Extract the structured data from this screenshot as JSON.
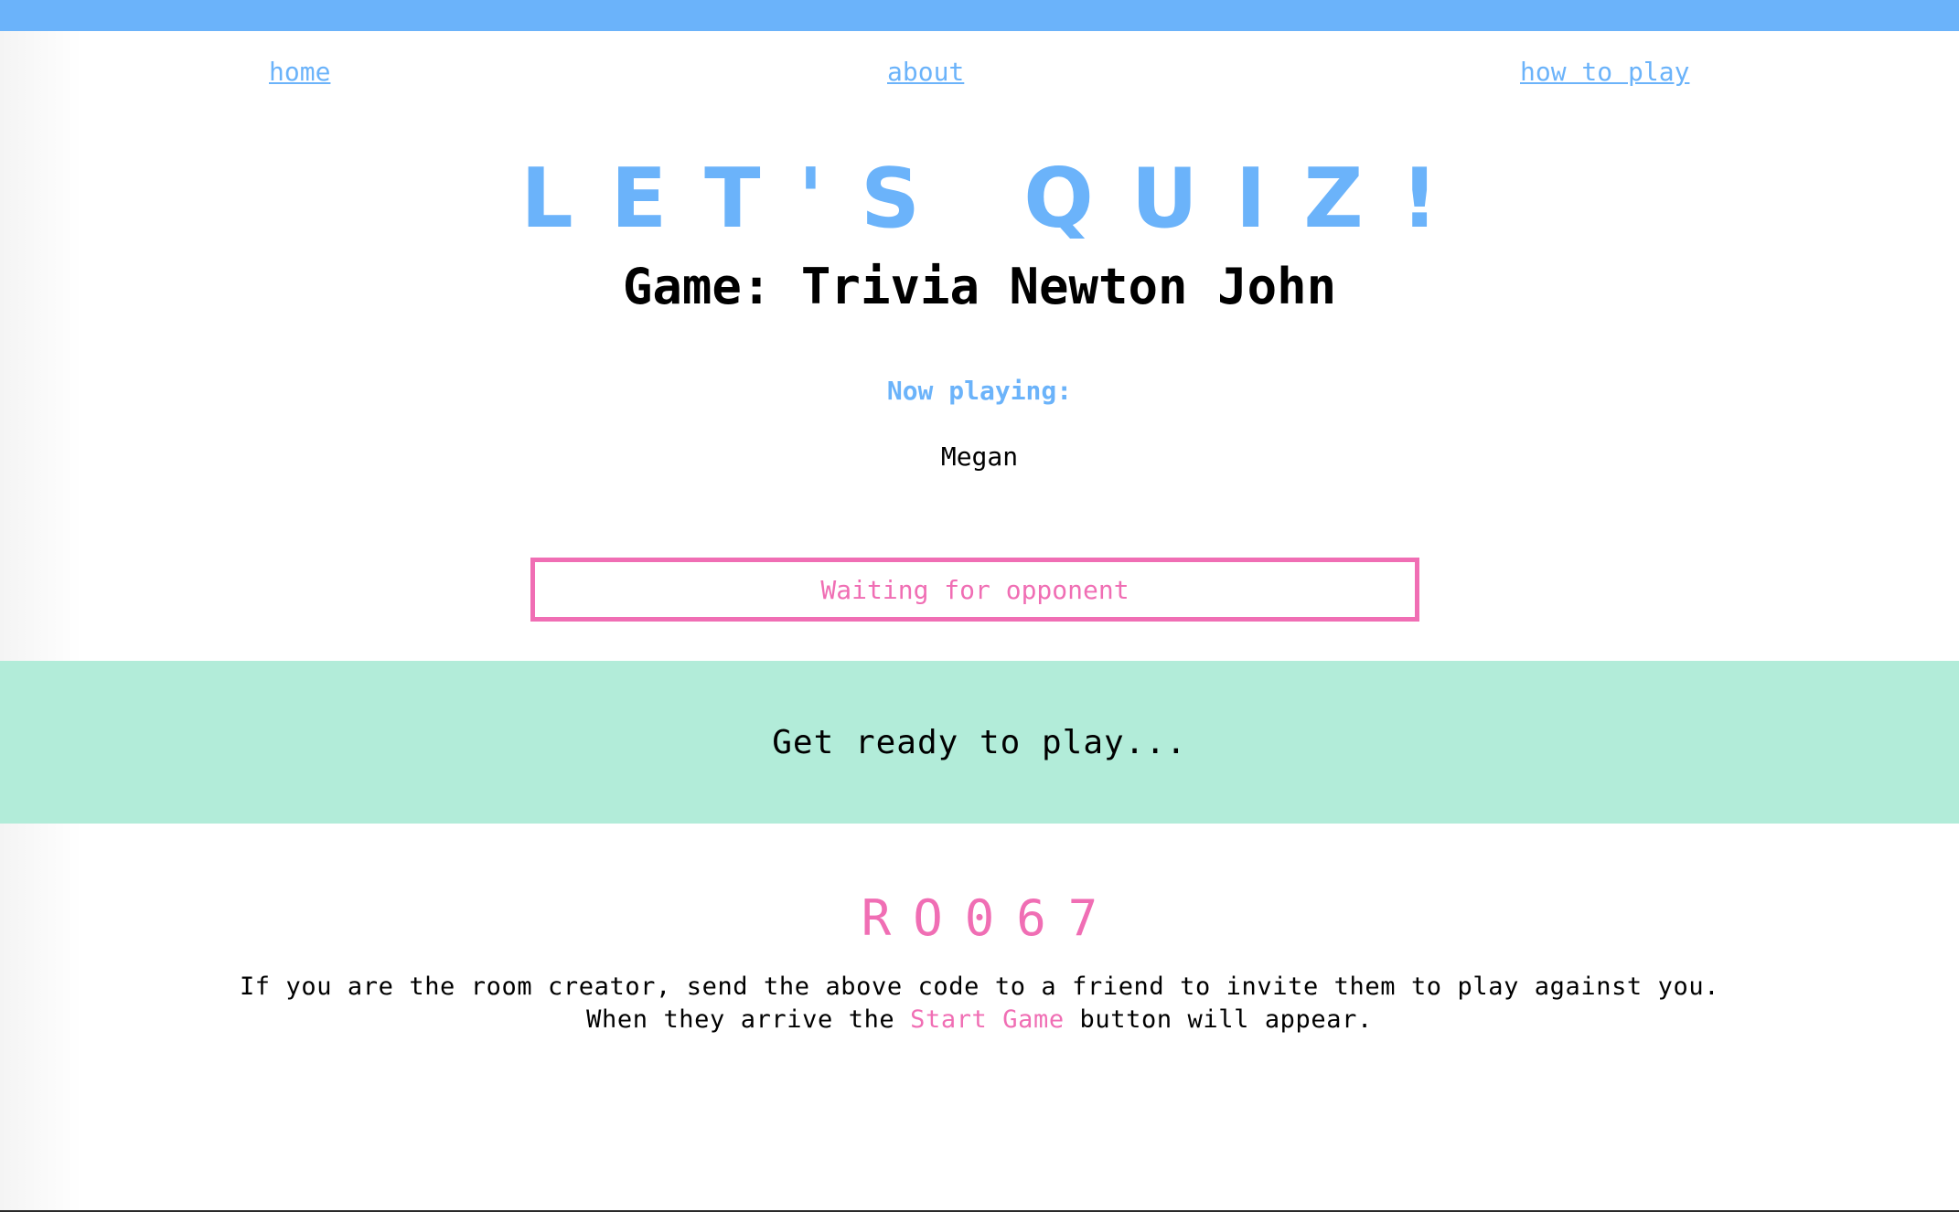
{
  "colors": {
    "accent_blue": "#6bb3fa",
    "accent_pink": "#f06eb4",
    "mint_band": "#b2ecd9",
    "text_dark": "#000000"
  },
  "nav": {
    "home": "home",
    "about": "about",
    "how_to_play": "how to play"
  },
  "header": {
    "title": "LET'S QUIZ!",
    "game_name": "Game: Trivia Newton John"
  },
  "players": {
    "label": "Now playing:",
    "list": [
      "Megan"
    ]
  },
  "status": {
    "waiting_text": "Waiting for opponent"
  },
  "ready_band": {
    "text": "Get ready to play..."
  },
  "room": {
    "code": "RO067",
    "instructions_before": "If you are the room creator, send the above code to a friend to invite them to play against you. When they arrive the ",
    "instructions_highlight": "Start Game",
    "instructions_after": " button will appear."
  }
}
